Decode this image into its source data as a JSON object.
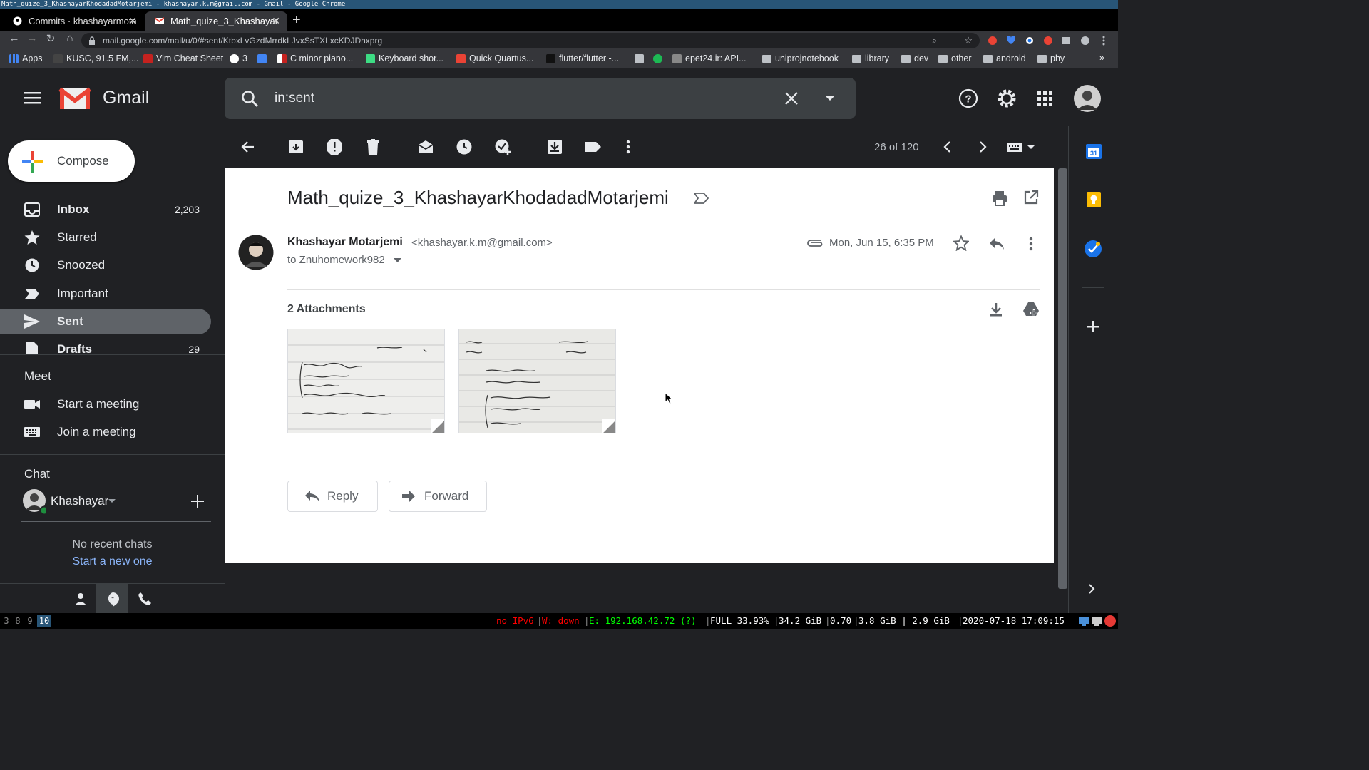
{
  "window_title": "Math_quize_3_KhashayarKhodadadMotarjemi - khashayar.k.m@gmail.com - Gmail - Google Chrome",
  "browser": {
    "tabs": [
      {
        "label": "Commits · khashayarmota"
      },
      {
        "label": "Math_quize_3_Khashayar"
      }
    ],
    "url": "mail.google.com/mail/u/0/#sent/KtbxLvGzdMrrdkLJvxSsTXLxcKDJDhxprg",
    "bookmarks": [
      {
        "label": "Apps"
      },
      {
        "label": "KUSC, 91.5 FM,..."
      },
      {
        "label": "Vim Cheat Sheet"
      },
      {
        "label": "3"
      },
      {
        "label": ""
      },
      {
        "label": "C minor piano..."
      },
      {
        "label": "Keyboard shor..."
      },
      {
        "label": "Quick Quartus..."
      },
      {
        "label": "flutter/flutter -..."
      },
      {
        "label": ""
      },
      {
        "label": ""
      },
      {
        "label": "epet24.ir: API..."
      },
      {
        "label": "uniprojnotebook"
      },
      {
        "label": "library"
      },
      {
        "label": "dev"
      },
      {
        "label": "other"
      },
      {
        "label": "android"
      },
      {
        "label": "phy"
      }
    ],
    "bookmarks_overflow": "»"
  },
  "gmail": {
    "logo_text": "Gmail",
    "search_query": "in:sent",
    "compose_label": "Compose",
    "nav": [
      {
        "label": "Inbox",
        "count": "2,203"
      },
      {
        "label": "Starred",
        "count": ""
      },
      {
        "label": "Snoozed",
        "count": ""
      },
      {
        "label": "Important",
        "count": ""
      },
      {
        "label": "Sent",
        "count": ""
      },
      {
        "label": "Drafts",
        "count": "29"
      }
    ],
    "meet": {
      "heading": "Meet",
      "start": "Start a meeting",
      "join": "Join a meeting"
    },
    "chat": {
      "heading": "Chat",
      "user": "Khashayar",
      "no_recent": "No recent chats",
      "start_new": "Start a new one"
    },
    "pagination": "26 of 120",
    "message": {
      "subject": "Math_quize_3_KhashayarKhodadadMotarjemi",
      "sender_name": "Khashayar Motarjemi",
      "sender_email": "<khashayar.k.m@gmail.com>",
      "to": "to Znuhomework982",
      "date": "Mon, Jun 15, 6:35 PM",
      "attachments_heading": "2 Attachments",
      "reply_label": "Reply",
      "forward_label": "Forward"
    }
  },
  "statusbar": {
    "workspaces": [
      "3",
      "8",
      "9",
      "10"
    ],
    "current_workspace": "10",
    "ipv6": "no IPv6",
    "wifi": "W: down",
    "eth": "E: 192.168.42.72 (?)",
    "battery": "FULL 33.93%",
    "disk": "34.2 GiB",
    "load": "0.70",
    "mem": "3.8 GiB | 2.9 GiB",
    "datetime": "2020-07-18 17:09:15"
  },
  "colors": {
    "accent_blue": "#8ab4f8",
    "sent_highlight": "#5f6368",
    "status_red": "#ff0000",
    "status_green": "#00ff00"
  }
}
